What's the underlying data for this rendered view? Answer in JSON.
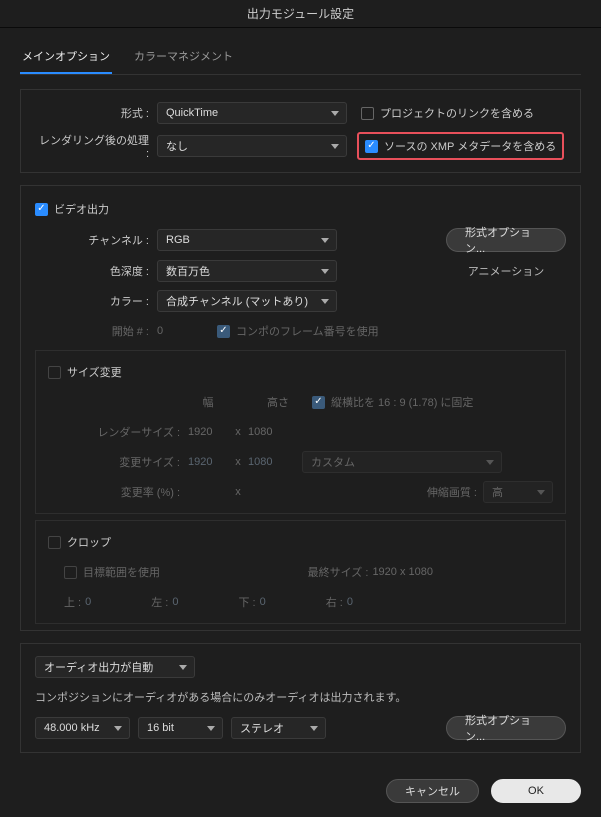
{
  "title": "出力モジュール設定",
  "tabs": {
    "main": "メインオプション",
    "color": "カラーマネジメント"
  },
  "format": {
    "label": "形式 :",
    "value": "QuickTime",
    "include_link_label": "プロジェクトのリンクを含める"
  },
  "post_render": {
    "label": "レンダリング後の処理 :",
    "value": "なし",
    "include_xmp_label": "ソースの XMP メタデータを含める"
  },
  "video": {
    "section_label": "ビデオ出力",
    "channel_label": "チャンネル :",
    "channel_value": "RGB",
    "format_options_btn": "形式オプション...",
    "depth_label": "色深度 :",
    "depth_value": "数百万色",
    "animation_label": "アニメーション",
    "color_label": "カラー :",
    "color_value": "合成チャンネル (マットあり)",
    "start_label": "開始 # :",
    "start_value": "0",
    "use_comp_frame_label": "コンポのフレーム番号を使用"
  },
  "resize": {
    "section_label": "サイズ変更",
    "width_label": "幅",
    "height_label": "高さ",
    "lock_ratio_label": "縦横比を 16 : 9 (1.78) に固定",
    "render_size_label": "レンダーサイズ :",
    "render_w": "1920",
    "render_h": "1080",
    "x": "x",
    "change_size_label": "変更サイズ :",
    "change_w": "1920",
    "change_h": "1080",
    "custom_label": "カスタム",
    "ratio_label": "変更率 (%) :",
    "ratio_x": "x",
    "stretch_quality_label": "伸縮画質 :",
    "stretch_quality_value": "高"
  },
  "crop": {
    "section_label": "クロップ",
    "use_target_label": "目標範囲を使用",
    "final_size_label": "最終サイズ :",
    "final_size_value": "1920 x 1080",
    "top_label": "上 :",
    "top_value": "0",
    "left_label": "左 :",
    "left_value": "0",
    "bottom_label": "下 :",
    "bottom_value": "0",
    "right_label": "右 :",
    "right_value": "0"
  },
  "audio": {
    "mode_value": "オーディオ出力が自動",
    "hint": "コンポジションにオーディオがある場合にのみオーディオは出力されます。",
    "rate_value": "48.000 kHz",
    "bit_value": "16 bit",
    "ch_value": "ステレオ",
    "format_options_btn": "形式オプション..."
  },
  "footer": {
    "cancel": "キャンセル",
    "ok": "OK"
  }
}
